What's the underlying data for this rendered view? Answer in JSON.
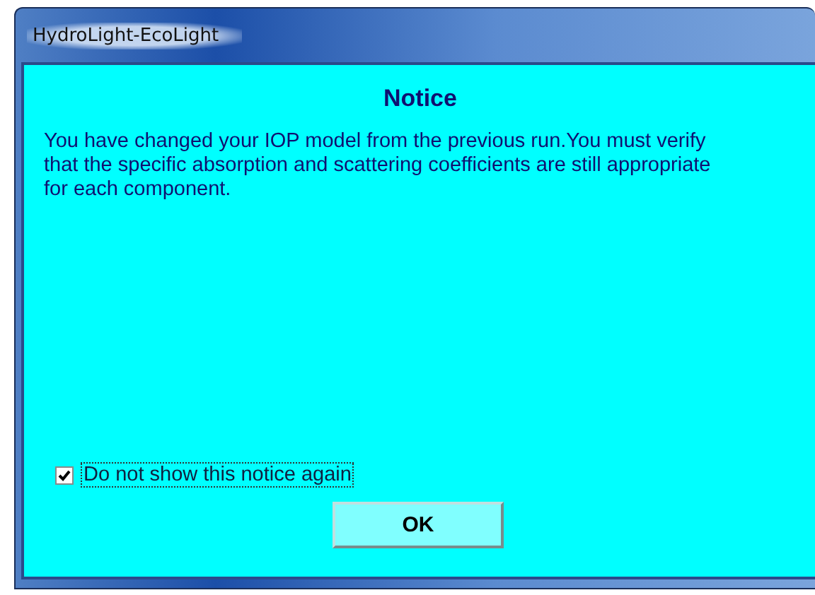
{
  "window": {
    "title": "HydroLight-EcoLight"
  },
  "heading": "Notice",
  "message": "You have changed your IOP model from the previous run.You must verify that the specific absorption and scattering coefficients are still appropriate for each component.",
  "checkbox": {
    "label": "Do not show this notice again",
    "checked": true
  },
  "buttons": [
    "OK"
  ]
}
